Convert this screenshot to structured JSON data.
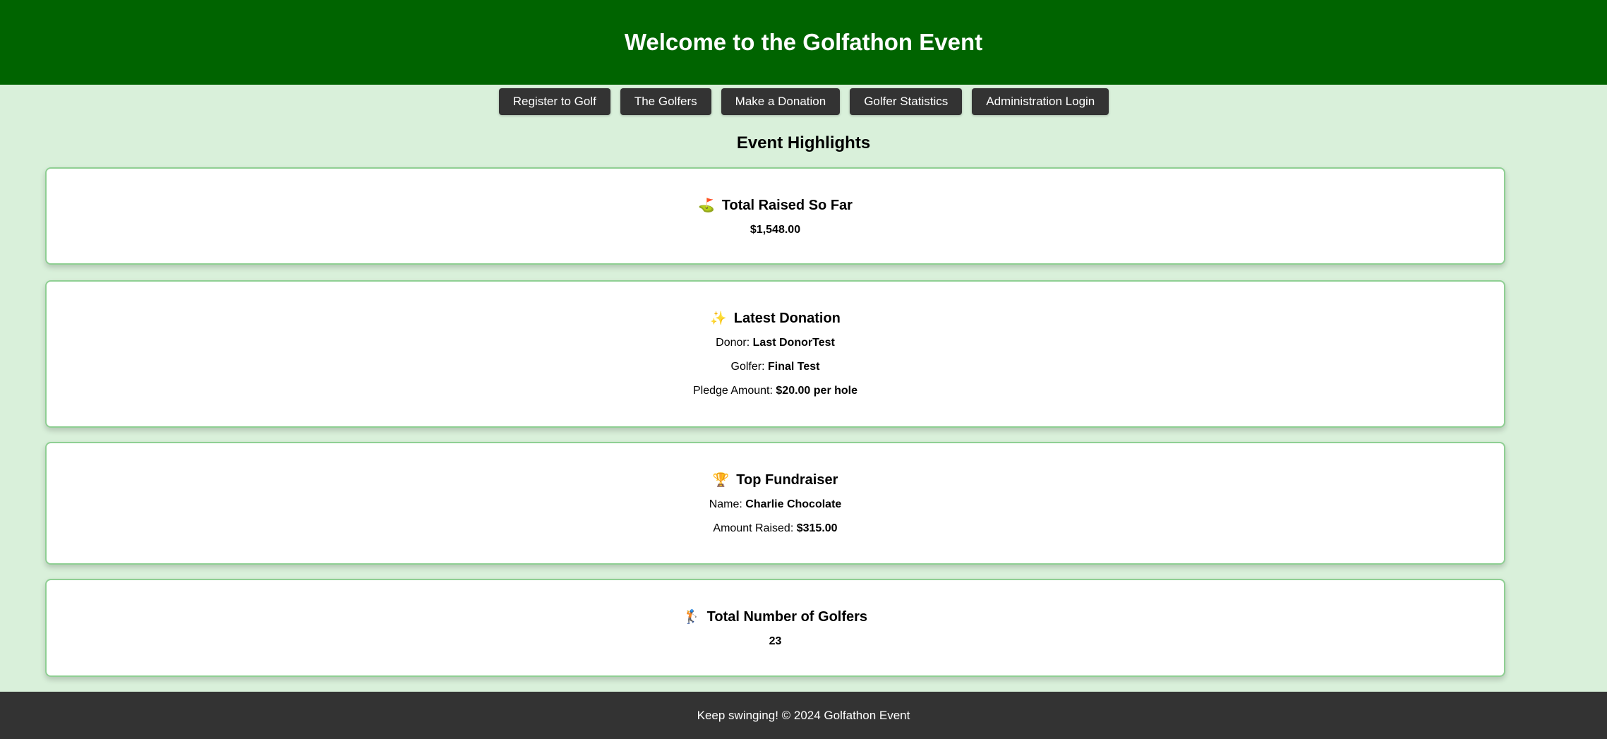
{
  "header": {
    "title": "Welcome to the Golfathon Event"
  },
  "nav": {
    "items": [
      {
        "label": "Register to Golf"
      },
      {
        "label": "The Golfers"
      },
      {
        "label": "Make a Donation"
      },
      {
        "label": "Golfer Statistics"
      },
      {
        "label": "Administration Login"
      }
    ]
  },
  "highlights": {
    "title": "Event Highlights",
    "total_raised": {
      "icon": "⛳",
      "icon_name": "golf-flag-icon",
      "heading": "Total Raised So Far",
      "value": "$1,548.00"
    },
    "latest_donation": {
      "icon": "✨",
      "icon_name": "sparkles-icon",
      "heading": "Latest Donation",
      "donor_label": "Donor:",
      "donor_value": "Last DonorTest",
      "golfer_label": "Golfer:",
      "golfer_value": "Final Test",
      "pledge_label": "Pledge Amount:",
      "pledge_value": "$20.00 per hole"
    },
    "top_fundraiser": {
      "icon": "🏆",
      "icon_name": "trophy-icon",
      "heading": "Top Fundraiser",
      "name_label": "Name:",
      "name_value": "Charlie Chocolate",
      "amount_label": "Amount Raised:",
      "amount_value": "$315.00"
    },
    "total_golfers": {
      "icon": "🏌",
      "icon_name": "golfer-icon",
      "heading": "Total Number of Golfers",
      "value": "23"
    }
  },
  "footer": {
    "text": "Keep swinging! © 2024 Golfathon Event"
  },
  "colors": {
    "header_bg": "#006400",
    "page_bg": "#d9f0da",
    "button_bg": "#333333",
    "footer_bg": "#333333",
    "card_border": "#8fcf93"
  }
}
